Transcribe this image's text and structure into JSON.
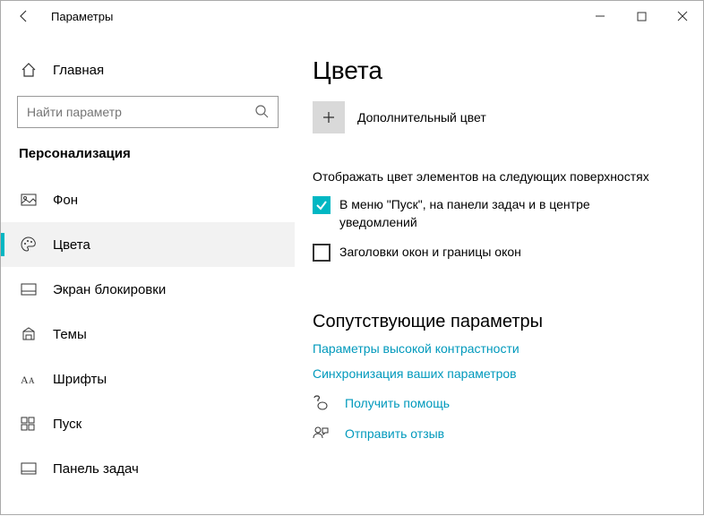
{
  "window": {
    "title": "Параметры"
  },
  "sidebar": {
    "home": "Главная",
    "search_placeholder": "Найти параметр",
    "section": "Персонализация",
    "items": [
      {
        "label": "Фон"
      },
      {
        "label": "Цвета"
      },
      {
        "label": "Экран блокировки"
      },
      {
        "label": "Темы"
      },
      {
        "label": "Шрифты"
      },
      {
        "label": "Пуск"
      },
      {
        "label": "Панель задач"
      }
    ]
  },
  "main": {
    "heading": "Цвета",
    "add_color": "Дополнительный цвет",
    "surfaces_label": "Отображать цвет элементов на следующих поверхностях",
    "cb1": "В меню \"Пуск\", на панели задач и в центре уведомлений",
    "cb2": "Заголовки окон и границы окон",
    "related_heading": "Сопутствующие параметры",
    "link1": "Параметры высокой контрастности",
    "link2": "Синхронизация ваших параметров",
    "help": "Получить помощь",
    "feedback": "Отправить отзыв"
  }
}
